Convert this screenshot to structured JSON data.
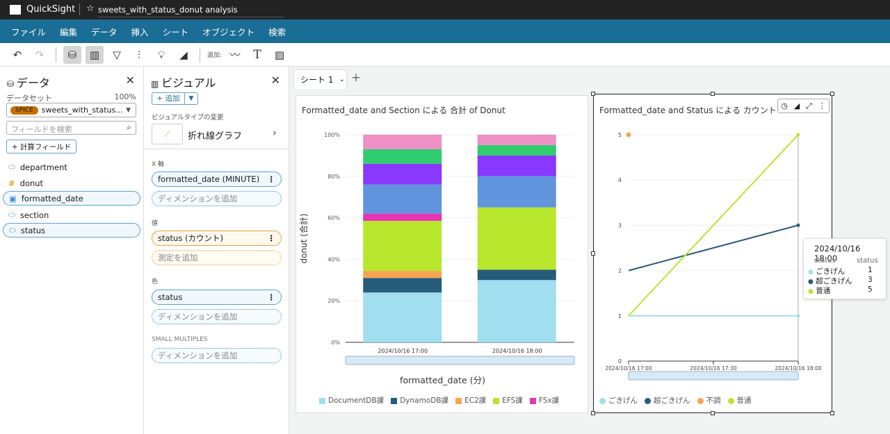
{
  "app": {
    "name": "QuickSight",
    "analysis_title": "sweets_with_status_donut analysis"
  },
  "menu": [
    "ファイル",
    "編集",
    "データ",
    "挿入",
    "シート",
    "オブジェクト",
    "検索"
  ],
  "toolbar": {
    "add_label": "追加:"
  },
  "data_panel": {
    "title": "データ",
    "dataset_label": "データセット",
    "dataset_pct": "100%",
    "spice_badge": "SPICE",
    "dataset_name": "sweets_with_status...",
    "search_placeholder": "フィールドを検索",
    "calc_field_button": "+ 計算フィールド",
    "fields": [
      {
        "name": "department",
        "type": "dimension",
        "selected": false
      },
      {
        "name": "donut",
        "type": "measure",
        "selected": false
      },
      {
        "name": "formatted_date",
        "type": "date",
        "selected": true
      },
      {
        "name": "section",
        "type": "dimension",
        "selected": false
      },
      {
        "name": "status",
        "type": "dimension",
        "selected": true
      }
    ]
  },
  "visual_panel": {
    "title": "ビジュアル",
    "add_button": "+ 追加",
    "type_change_label": "ビジュアルタイプの変更",
    "visual_type": "折れ線グラフ",
    "x_axis_label": "X 軸",
    "x_axis_field": "formatted_date (MINUTE)",
    "add_dimension": "ディメンションを追加",
    "value_label": "値",
    "value_field": "status (カウント)",
    "add_measure": "測定を追加",
    "color_label": "色",
    "color_field": "status",
    "small_multiples_label": "SMALL MULTIPLES"
  },
  "sheet_tab": "シート 1",
  "chart_data": [
    {
      "type": "bar",
      "stacked": "percent",
      "title": "Formatted_date and Section による 合計 of Donut",
      "xlabel": "formatted_date (分)",
      "ylabel": "donut (合計)",
      "ylim": [
        0,
        100
      ],
      "yticks": [
        "0%",
        "20%",
        "40%",
        "60%",
        "80%",
        "100%"
      ],
      "grid": true,
      "legend": "bottom",
      "categories": [
        "2024/10/16 17:00",
        "2024/10/16 18:00"
      ],
      "series": [
        {
          "name": "DocumentDB課",
          "color": "#a0def0",
          "values": [
            24,
            30
          ]
        },
        {
          "name": "DynamoDB課",
          "color": "#275b7a",
          "values": [
            7,
            5
          ]
        },
        {
          "name": "EC2課",
          "color": "#f5a552",
          "values": [
            3.5,
            0
          ]
        },
        {
          "name": "EFS課",
          "color": "#b8e62d",
          "values": [
            24,
            30
          ]
        },
        {
          "name": "FSx課",
          "color": "#e535b4",
          "values": [
            3.5,
            0
          ]
        },
        {
          "color": "#6095de",
          "values": [
            14,
            15
          ]
        },
        {
          "color": "#8838ff",
          "values": [
            10,
            10
          ]
        },
        {
          "color": "#30cc70",
          "values": [
            7,
            5
          ]
        },
        {
          "color": "#ec90c6",
          "values": [
            7,
            5
          ]
        }
      ]
    },
    {
      "type": "line",
      "title": "Formatted_date and Status による カウント o",
      "ylim": [
        0,
        5
      ],
      "yticks": [
        "0",
        "1",
        "2",
        "3",
        "4",
        "5"
      ],
      "grid": true,
      "legend": "bottom",
      "xticks": [
        "2024/10/16 17:00",
        "2024/10/16 17:30",
        "2024/10/16 18:00"
      ],
      "x": [
        "2024/10/16 17:00",
        "2024/10/16 18:00"
      ],
      "series": [
        {
          "name": "ごきげん",
          "color": "#a0def0",
          "values": [
            1,
            1
          ]
        },
        {
          "name": "超ごきげん",
          "color": "#275b7a",
          "values": [
            2,
            3
          ]
        },
        {
          "name": "不調",
          "color": "#f5a552",
          "values": [
            5,
            null
          ]
        },
        {
          "name": "普通",
          "color": "#b8e62d",
          "values": [
            1,
            5
          ]
        }
      ],
      "tooltip": {
        "title": "2024/10/16 18:00",
        "col1": "status",
        "col2": "status",
        "rows": [
          {
            "label": "ごきげん",
            "value": "1",
            "color": "#a0def0"
          },
          {
            "label": "超ごきげん",
            "value": "3",
            "color": "#275b7a"
          },
          {
            "label": "普通",
            "value": "5",
            "color": "#b8e62d"
          }
        ]
      }
    }
  ]
}
